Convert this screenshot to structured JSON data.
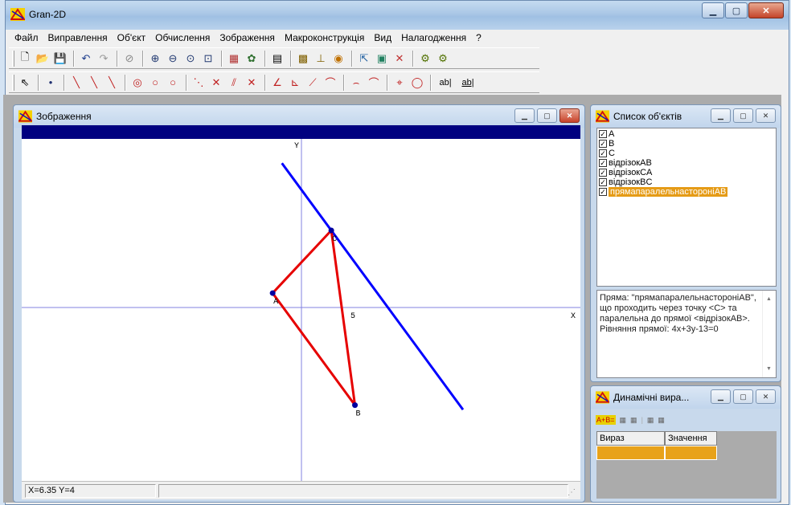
{
  "window": {
    "title": "Gran-2D"
  },
  "menu": [
    "Файл",
    "Виправлення",
    "Об'єкт",
    "Обчислення",
    "Зображення",
    "Макроконструкція",
    "Вид",
    "Налагодження",
    "?"
  ],
  "toolbar1": [
    "new-icon",
    "open-icon",
    "save-icon",
    "|",
    "undo-icon",
    "redo-icon",
    "|",
    "no-icon",
    "|",
    "zoom-in-icon",
    "zoom-out-icon",
    "zoom-fit-icon",
    "zoom-window-icon",
    "|",
    "image-icon",
    "palette-icon",
    "|",
    "calculator-icon",
    "|",
    "chart-icon",
    "measure-icon",
    "target-icon",
    "|",
    "macro-icon",
    "grid-icon",
    "shape-icon",
    "|",
    "tool-icon",
    "tool2-icon"
  ],
  "toolbar2": [
    "pointer-icon",
    "|",
    "point-icon",
    "|",
    "segment-icon",
    "ray-icon",
    "line-icon",
    "|",
    "circle-icon",
    "circle2-icon",
    "circle3-icon",
    "|",
    "midpoint-icon",
    "perpendicular-icon",
    "parallel-icon",
    "intersect-icon",
    "|",
    "angle-icon",
    "bisector-icon",
    "tangent-icon",
    "arc-icon",
    "|",
    "arc2-icon",
    "arc3-icon",
    "|",
    "polygon-icon",
    "ellipse-icon",
    "|",
    "label-icon",
    "label-box-icon"
  ],
  "toolbar2_text": {
    "label1": "ab|",
    "label2": "ab|"
  },
  "drawing_window": {
    "title": "Зображення",
    "axis_x_label": "X",
    "axis_y_label": "Y",
    "tick_label": "5",
    "points": [
      {
        "name": "A",
        "x": -2.8,
        "y": 1.4
      },
      {
        "name": "B",
        "x": 5.2,
        "y": -9.5
      },
      {
        "name": "C",
        "x": 2.9,
        "y": 7.5
      }
    ],
    "segment_color": "#e60000",
    "line_color": "#0000ff",
    "point_color": "#0000a0"
  },
  "status": {
    "coords": "X=6.35 Y=4"
  },
  "object_list": {
    "title": "Список об'єктів",
    "items": [
      {
        "label": "A",
        "checked": true,
        "selected": false
      },
      {
        "label": "B",
        "checked": true,
        "selected": false
      },
      {
        "label": "C",
        "checked": true,
        "selected": false
      },
      {
        "label": "відрізокAB",
        "checked": true,
        "selected": false
      },
      {
        "label": "відрізокCA",
        "checked": true,
        "selected": false
      },
      {
        "label": "відрізокBC",
        "checked": true,
        "selected": false
      },
      {
        "label": "прямапаралельнасторонiAB",
        "checked": true,
        "selected": true
      }
    ],
    "description": "Пряма: \"прямапаралельнасторонiAB\", що проходить через точку <C> та паралельна до прямої <відрізокAB>. Рівняння прямої: 4x+3y-13=0"
  },
  "dynamic_window": {
    "title": "Динамічні вира...",
    "col_expr": "Вираз",
    "col_value": "Значення"
  }
}
